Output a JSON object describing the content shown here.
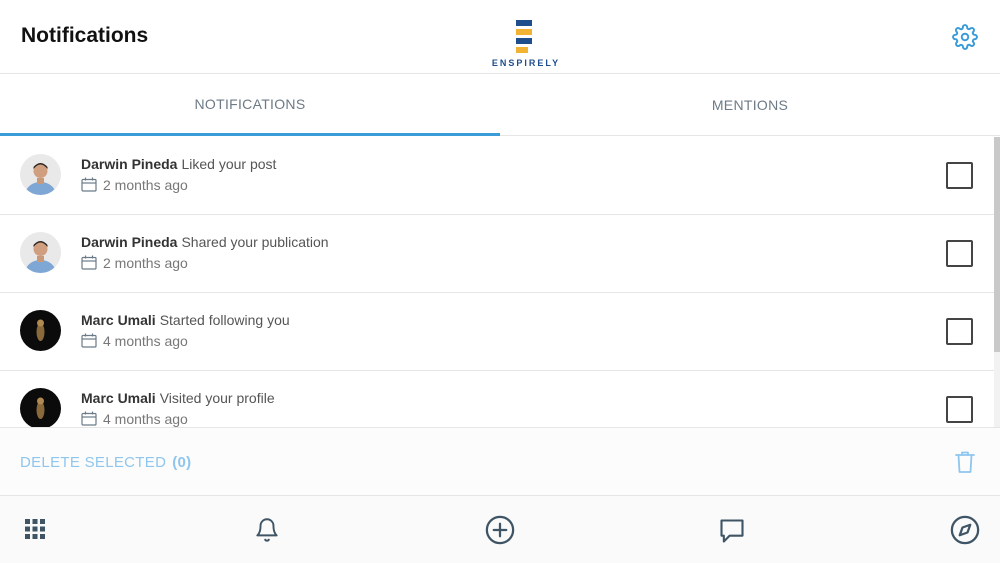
{
  "header": {
    "title": "Notifications",
    "logo_text": "ENSPIRELY",
    "settings_icon": "gear-icon",
    "logo_colors": [
      "#1f4e8c",
      "#f2b233",
      "#1f4e8c",
      "#f2b233"
    ]
  },
  "tabs": [
    {
      "label": "NOTIFICATIONS",
      "active": true
    },
    {
      "label": "MENTIONS",
      "active": false
    }
  ],
  "notifications": [
    {
      "name": "Darwin Pineda",
      "action": "Liked your post",
      "time": "2 months ago",
      "checked": false
    },
    {
      "name": "Darwin Pineda",
      "action": "Shared your publication",
      "time": "2 months ago",
      "checked": false
    },
    {
      "name": "Marc Umali",
      "action": "Started following you",
      "time": "4 months ago",
      "checked": false
    },
    {
      "name": "Marc Umali",
      "action": "Visited your profile",
      "time": "4 months ago",
      "checked": false
    }
  ],
  "actions": {
    "delete_label": "DELETE SELECTED",
    "delete_count": "(0)",
    "trash_icon": "trash-icon"
  },
  "bottom_nav": [
    {
      "icon": "grid-icon"
    },
    {
      "icon": "bell-icon"
    },
    {
      "icon": "plus-circle-icon"
    },
    {
      "icon": "chat-icon"
    },
    {
      "icon": "compass-icon"
    }
  ],
  "colors": {
    "accent": "#3a9bd9",
    "delete_text": "#8fc6ee",
    "icon": "#3f5566"
  }
}
